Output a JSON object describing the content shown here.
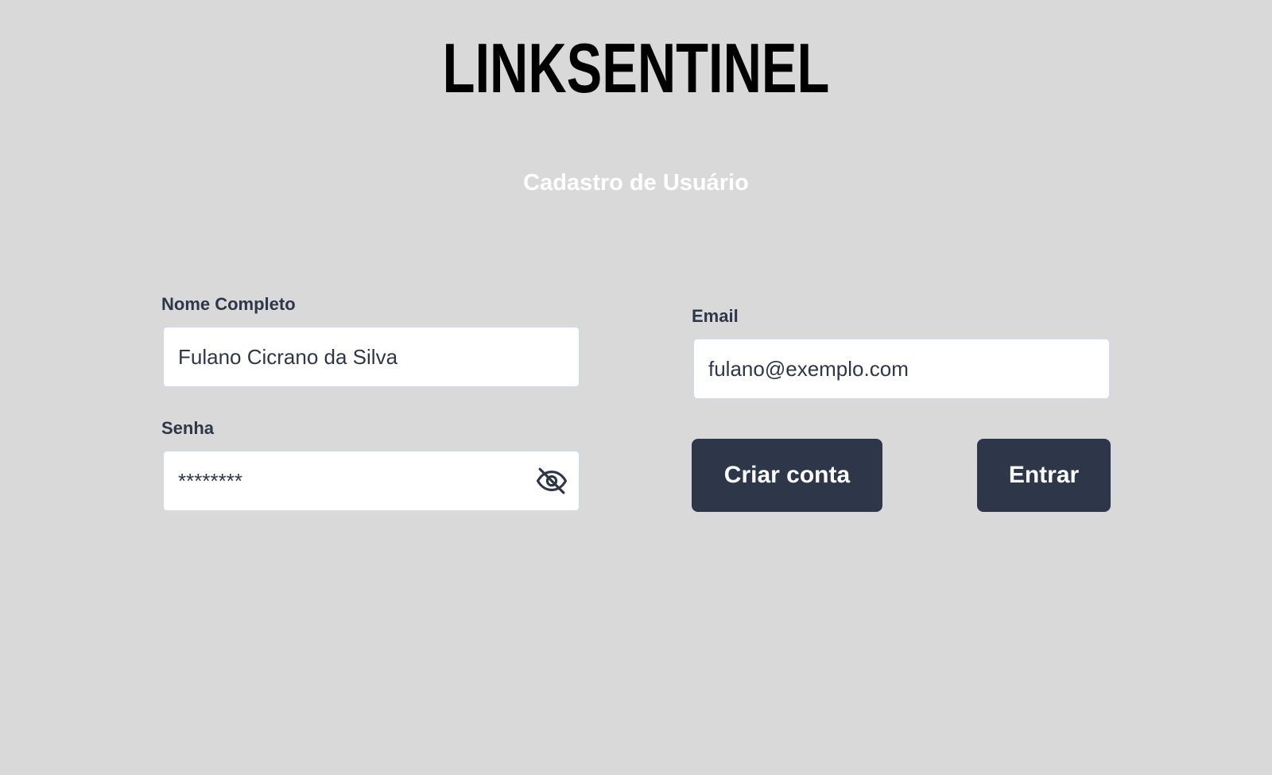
{
  "app": {
    "logo_text": "LINKSENTINEL",
    "page_title": "Cadastro de Usuário"
  },
  "form": {
    "full_name": {
      "label": "Nome Completo",
      "value": "Fulano Cicrano da Silva"
    },
    "email": {
      "label": "Email",
      "value": "fulano@exemplo.com"
    },
    "password": {
      "label": "Senha",
      "value": "********",
      "toggle_icon": "eye-off-icon"
    }
  },
  "actions": {
    "create_account_label": "Criar conta",
    "login_label": "Entrar"
  },
  "colors": {
    "background": "#d9d9d9",
    "button": "#2e3649",
    "text": "#2f3648"
  }
}
